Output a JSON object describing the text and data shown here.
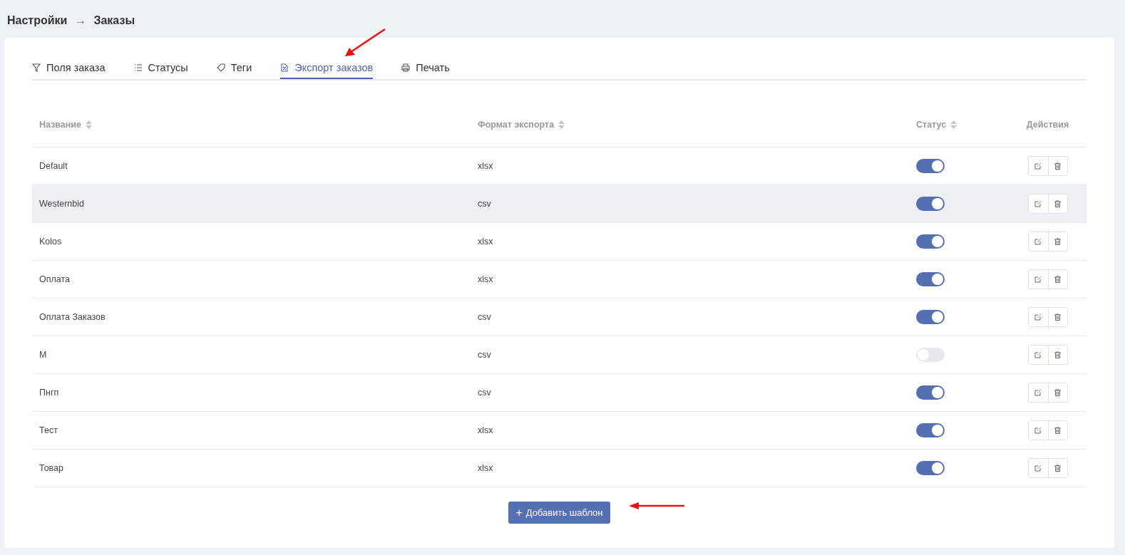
{
  "breadcrumb": {
    "items": [
      "Настройки",
      "Заказы"
    ],
    "separator": "→"
  },
  "tabs": [
    {
      "label": "Поля заказа",
      "kind": "filter",
      "selected": false
    },
    {
      "label": "Статусы",
      "kind": "list",
      "selected": false
    },
    {
      "label": "Теги",
      "kind": "tag",
      "selected": false
    },
    {
      "label": "Экспорт заказов",
      "kind": "file",
      "selected": true
    },
    {
      "label": "Печать",
      "kind": "printer",
      "selected": false
    }
  ],
  "table": {
    "columns": [
      {
        "label": "Название",
        "sortable": true
      },
      {
        "label": "Формат экспорта",
        "sortable": true
      },
      {
        "label": "Статус",
        "sortable": true
      },
      {
        "label": "Действия",
        "sortable": false
      }
    ],
    "rows": [
      {
        "name": "Default",
        "format": "xlsx",
        "on": true,
        "highlighted": false
      },
      {
        "name": "Westernbid",
        "format": "csv",
        "on": true,
        "highlighted": true
      },
      {
        "name": "Kolos",
        "format": "xlsx",
        "on": true,
        "highlighted": false
      },
      {
        "name": "Оплата",
        "format": "xlsx",
        "on": true,
        "highlighted": false
      },
      {
        "name": "Оплата Заказов",
        "format": "csv",
        "on": true,
        "highlighted": false
      },
      {
        "name": "M",
        "format": "csv",
        "on": false,
        "highlighted": false
      },
      {
        "name": "Пнгп",
        "format": "csv",
        "on": true,
        "highlighted": false
      },
      {
        "name": "Тест",
        "format": "xlsx",
        "on": true,
        "highlighted": false
      },
      {
        "name": "Товар",
        "format": "xlsx",
        "on": true,
        "highlighted": false
      }
    ]
  },
  "add_button": {
    "icon": "+",
    "label": "Добавить шаблон"
  }
}
